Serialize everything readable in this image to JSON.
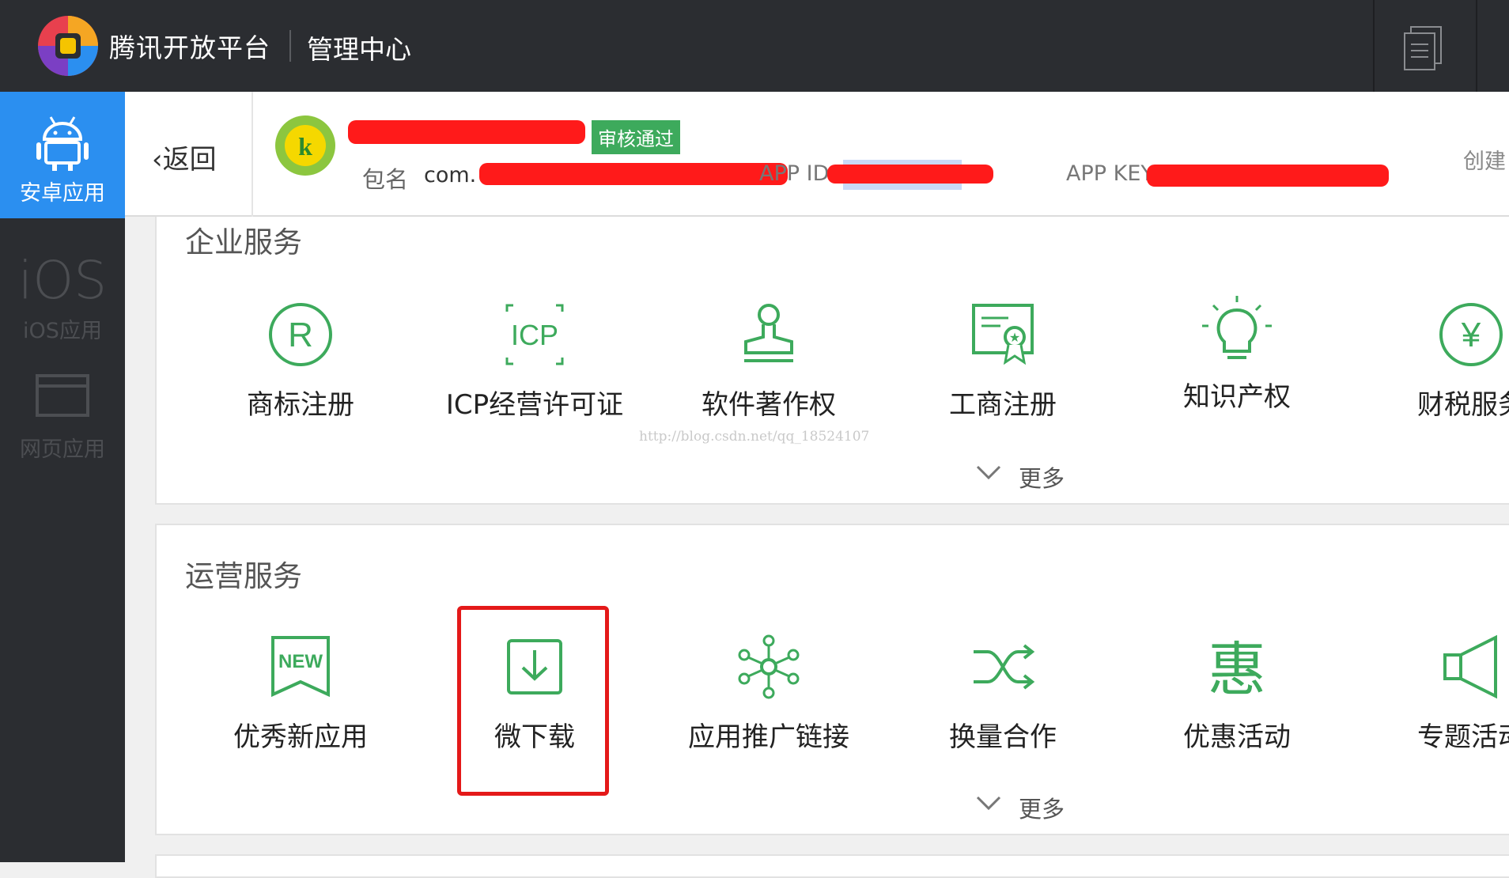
{
  "header": {
    "brand": "腾讯开放平台",
    "console": "管理中心"
  },
  "sidebar": {
    "items": [
      {
        "label": "安卓应用",
        "icon": "android-icon",
        "active": true
      },
      {
        "label": "iOS应用",
        "icon": "ios-icon",
        "active": false
      },
      {
        "label": "网页应用",
        "icon": "web-window-icon",
        "active": false
      }
    ]
  },
  "app_header": {
    "back_label": "返回",
    "status_badge": "审核通过",
    "package_label": "包名",
    "package_value": "com.",
    "app_id_label": "APP ID",
    "app_key_label": "APP KEY",
    "created_label": "创建"
  },
  "sections": {
    "enterprise": {
      "title": "企业服务",
      "items": [
        "商标注册",
        "ICP经营许可证",
        "软件著作权",
        "工商注册",
        "知识产权",
        "财税服务"
      ],
      "more": "更多"
    },
    "operations": {
      "title": "运营服务",
      "items": [
        "优秀新应用",
        "微下载",
        "应用推广链接",
        "换量合作",
        "优惠活动",
        "专题活动"
      ],
      "more": "更多"
    }
  },
  "watermark": "http://blog.csdn.net/qq_18524107",
  "colors": {
    "accent_blue": "#2b8ff0",
    "service_green": "#3daa5c",
    "highlight_red": "#e41919",
    "topbar": "#2b2d31"
  }
}
